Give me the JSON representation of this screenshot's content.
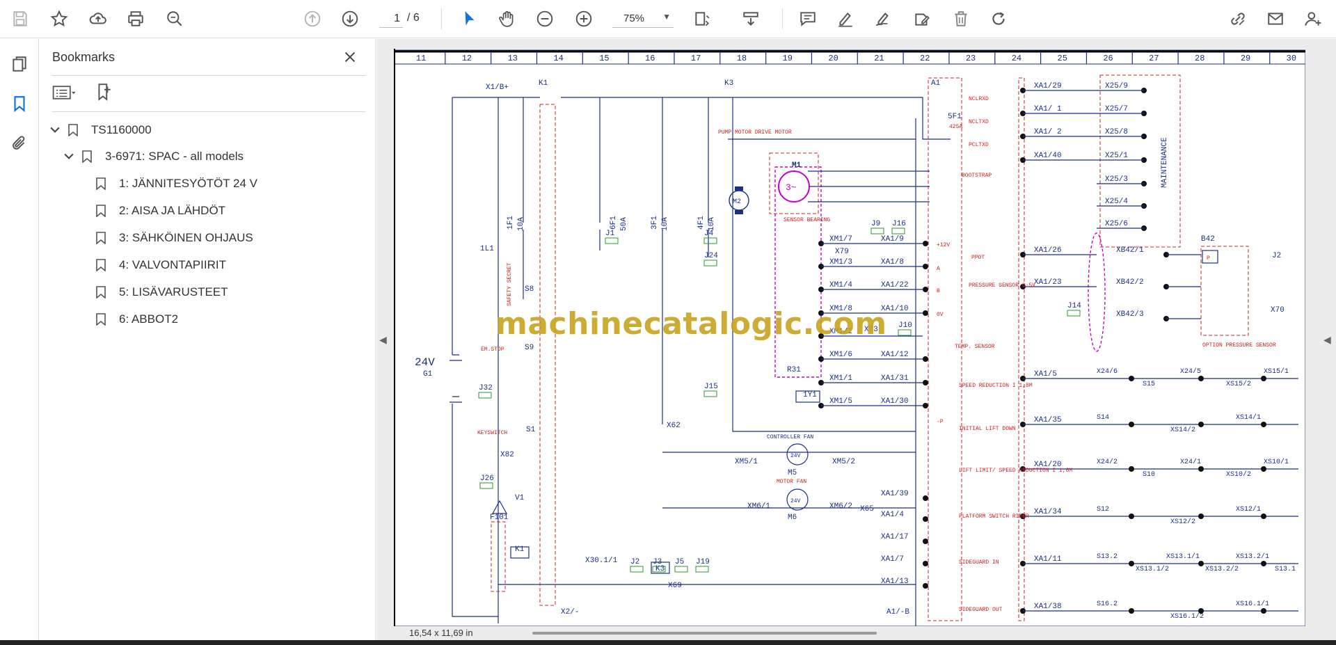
{
  "toolbar": {
    "page_current": "1",
    "page_total": "/ 6",
    "zoom": "75%"
  },
  "panel": {
    "title": "Bookmarks"
  },
  "bookmarks": [
    {
      "label": "TS1160000"
    },
    {
      "label": "3-6971: SPAC - all models"
    },
    {
      "label": "1: JÄNNITESYÖTÖT 24 V"
    },
    {
      "label": "2: AISA JA LÄHDÖT"
    },
    {
      "label": "3: SÄHKÖINEN OHJAUS"
    },
    {
      "label": "4: VALVONTAPIIRIT"
    },
    {
      "label": "5: LISÄVARUSTEET"
    },
    {
      "label": "6: ABBOT2"
    }
  ],
  "document": {
    "page_size": "16,54 x 11,69 in",
    "watermark": "machinecatalogic.com",
    "column_numbers": [
      "11",
      "12",
      "13",
      "14",
      "15",
      "16",
      "17",
      "18",
      "19",
      "20",
      "21",
      "22",
      "23",
      "24",
      "25",
      "26",
      "27",
      "28",
      "29",
      "30"
    ],
    "labels": {
      "voltage": "24V",
      "battery": "G1",
      "k1": "K1",
      "k3": "K3",
      "x1b": "X1/B+",
      "a1": "A1",
      "fuse5": "5F1",
      "fuse5_rating": "425A",
      "pump_drive": "PUMP MOTOR  DRIVE MOTOR",
      "m1": "M1",
      "m2": "M2",
      "f1": "1F1",
      "f1_rating": "10A",
      "f6": "6F1",
      "f6_rating": "50A",
      "f3": "3F1",
      "f3_rating": "10A",
      "f4": "4F1",
      "f4_rating": "10A",
      "sensor_bearing": "SENSOR BEARING",
      "maintenance": "MAINTENANCE",
      "b42": "B42",
      "option_pressure": "OPTION PRESSURE SENSOR",
      "temp_sensor": "TEMP. SENSOR",
      "r31": "R31",
      "y1": "1Y1",
      "controller_fan": "CONTROLLER FAN",
      "motor_fan": "MOTOR FAN",
      "m5": "M5",
      "m6": "M6",
      "x62": "X62",
      "x82": "X82",
      "f101": "F101",
      "x69": "X69",
      "x65": "X65",
      "x70": "X70",
      "x79": "X79",
      "x73": "X73",
      "em_stop": "EM.STOP",
      "keyswitch": "KEYSWITCH",
      "safety_secret": "SAFETY SECRET",
      "x30": "X30.1/1",
      "x2": "X2/-",
      "a1b": "A1/-B",
      "ppot": "PPOT",
      "pressure_sensor": "PRESSURE SENSOR 0-5V",
      "bootstrap": "BOOTSTRAP",
      "nclrxd": "NCLRXD",
      "ncltxd": "NCLTXD",
      "pcltxd": "PCLTXD",
      "speed_red": "SPEED REDUCTION I 1,8M",
      "initial_lift": "INITIAL LIFT DOWN",
      "lift_limit": "LIFT LIMIT/ SPEED REDUCTION I 1,8M",
      "platform_switch": "PLATFORM SWITCH RIDER",
      "sideguard_in": "SIDEGUARD IN",
      "sideguard_out": "SIDEGUARD OUT"
    },
    "xa_pins": [
      "XA1/29",
      "XA1/ 1",
      "XA1/ 2",
      "XA1/40",
      "XA1/26",
      "XA1/23",
      "XA1/5",
      "XA1/35",
      "XA1/20",
      "XA1/34",
      "XA1/11",
      "XA1/38"
    ],
    "x25_pins": [
      "X25/9",
      "X25/7",
      "X25/8",
      "X25/1",
      "X25/3",
      "X25/4",
      "X25/6"
    ],
    "xm_left": [
      "XM1/7",
      "XM1/3",
      "XM1/4",
      "XM1/8",
      "XM1/2",
      "XM1/6",
      "XM1/1",
      "XM1/5"
    ],
    "xa_mid": [
      "XA1/9",
      "XA1/8",
      "XA1/22",
      "XA1/10",
      "XA1/12",
      "XA1/31",
      "XA1/30",
      "XA1/39",
      "XA1/4",
      "XA1/17",
      "XA1/7",
      "XA1/13"
    ],
    "a1_terms": [
      "+12V",
      "A",
      "B",
      "0V",
      "-P"
    ],
    "xb42": [
      "XB42/1",
      "XB42/2",
      "XB42/3"
    ],
    "switch_row1": [
      "X24/6",
      "S15",
      "X24/5",
      "XS15/2",
      "XS15/1"
    ],
    "switch_row2": [
      "S14",
      "XS14/2",
      "XS14/1"
    ],
    "switch_row3": [
      "X24/2",
      "S10",
      "X24/1",
      "XS10/2",
      "XS10/1"
    ],
    "switch_row4": [
      "S12",
      "XS12/2",
      "XS12/1"
    ],
    "switch_row5": [
      "S13.2",
      "XS13.1/2",
      "XS13.1/1",
      "XS13.2/2",
      "XS13.2/1",
      "S13.1"
    ],
    "switch_row6": [
      "S16.2",
      "XS16.1/2",
      "XS16.1/1"
    ],
    "jumpers": [
      "J1",
      "J4",
      "J24",
      "J15",
      "J9",
      "J16",
      "J10",
      "J14",
      "J32",
      "J26",
      "J2",
      "J3",
      "J5",
      "J19"
    ],
    "misc": [
      "1L1",
      "S8",
      "S9",
      "S1",
      "V1",
      "K1",
      "K3",
      "XM5/1",
      "XM5/2",
      "XM6/1",
      "XM6/2",
      "J2"
    ]
  },
  "colors": {
    "accent": "#1473e6",
    "schematic_blue": "#1a2f8c",
    "schematic_red": "#d42020",
    "magenta": "#cc00cc",
    "watermark": "#c8a41e"
  }
}
